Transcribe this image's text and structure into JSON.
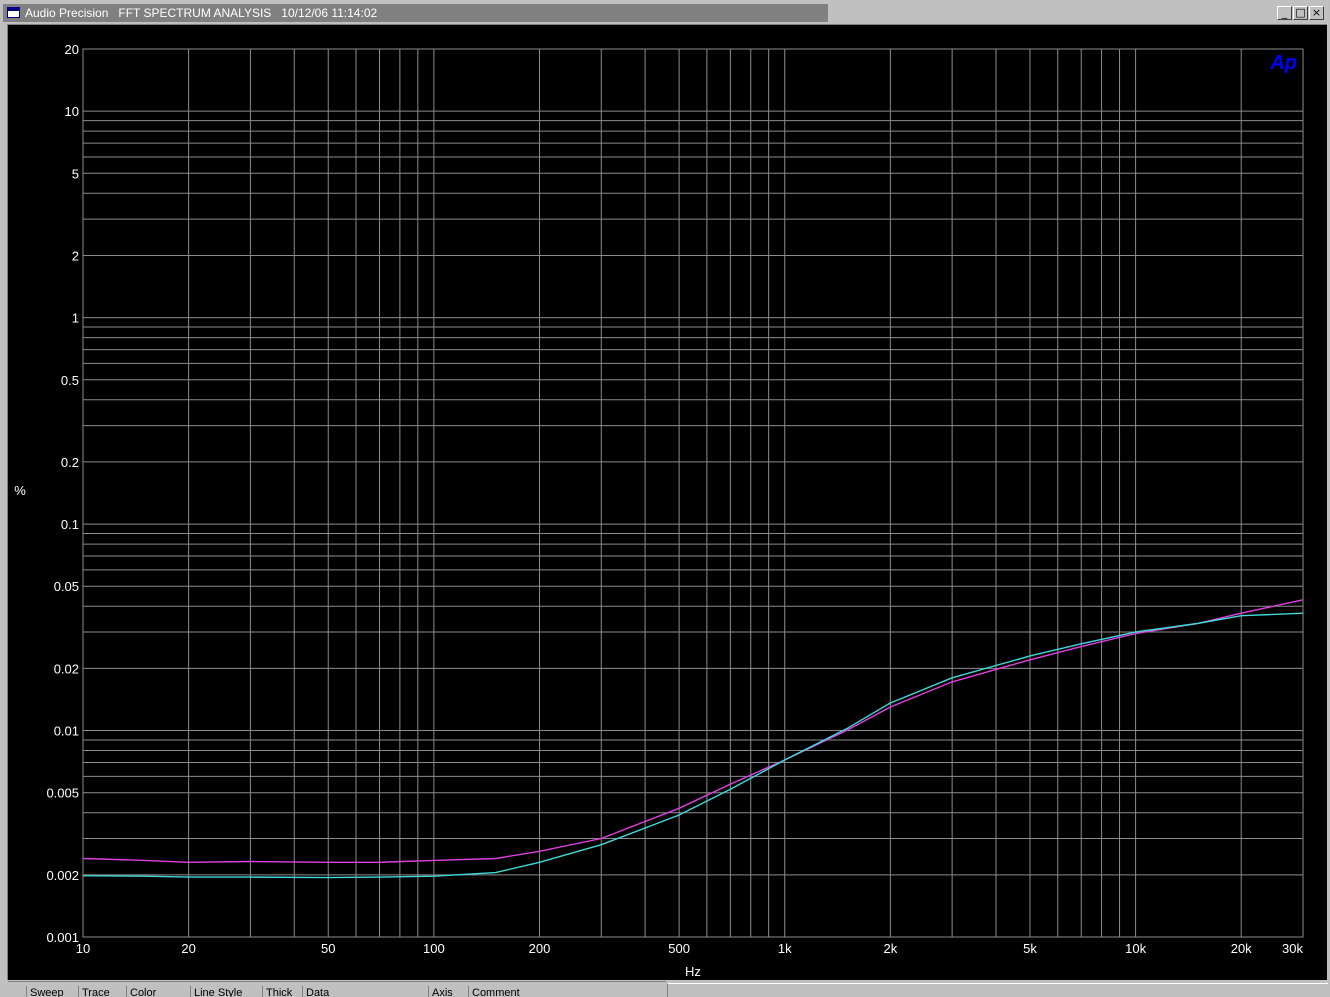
{
  "window": {
    "title": "Audio Precision   FFT SPECTRUM ANALYSIS   10/12/06 11:14:02",
    "minimize_glyph": "_",
    "maximize_glyph": "□",
    "close_glyph": "×"
  },
  "logo_text": "Ap",
  "legend_headers": [
    "Sweep",
    "Trace",
    "Color",
    "Line Style",
    "Thick",
    "Data",
    "Axis",
    "Comment"
  ],
  "colors": {
    "background": "#000000",
    "grid": "#8c8c8c",
    "axis_text": "#ffffff",
    "logo": "#0000ff"
  },
  "chart_data": {
    "type": "line",
    "title": "FFT SPECTRUM ANALYSIS",
    "xlabel": "Hz",
    "ylabel": "%",
    "x_scale": "log",
    "y_scale": "log",
    "xlim": [
      10,
      30000
    ],
    "ylim": [
      0.001,
      20
    ],
    "x_ticks": [
      {
        "v": 10,
        "label": "10"
      },
      {
        "v": 20,
        "label": "20"
      },
      {
        "v": 50,
        "label": "50"
      },
      {
        "v": 100,
        "label": "100"
      },
      {
        "v": 200,
        "label": "200"
      },
      {
        "v": 500,
        "label": "500"
      },
      {
        "v": 1000,
        "label": "1k"
      },
      {
        "v": 2000,
        "label": "2k"
      },
      {
        "v": 5000,
        "label": "5k"
      },
      {
        "v": 10000,
        "label": "10k"
      },
      {
        "v": 20000,
        "label": "20k"
      },
      {
        "v": 30000,
        "label": "30k"
      }
    ],
    "y_ticks": [
      {
        "v": 20,
        "label": "20"
      },
      {
        "v": 10,
        "label": "10"
      },
      {
        "v": 5,
        "label": "5"
      },
      {
        "v": 2,
        "label": "2"
      },
      {
        "v": 1,
        "label": "1"
      },
      {
        "v": 0.5,
        "label": "0.5"
      },
      {
        "v": 0.2,
        "label": "0.2"
      },
      {
        "v": 0.1,
        "label": "0.1"
      },
      {
        "v": 0.05,
        "label": "0.05"
      },
      {
        "v": 0.02,
        "label": "0.02"
      },
      {
        "v": 0.01,
        "label": "0.01"
      },
      {
        "v": 0.005,
        "label": "0.005"
      },
      {
        "v": 0.002,
        "label": "0.002"
      },
      {
        "v": 0.001,
        "label": "0.001"
      }
    ],
    "grid": true,
    "series": [
      {
        "color": "#e040e0",
        "x": [
          10,
          15,
          20,
          30,
          50,
          70,
          100,
          150,
          200,
          300,
          500,
          700,
          1000,
          1500,
          2000,
          3000,
          5000,
          7000,
          10000,
          15000,
          20000,
          30000
        ],
        "y": [
          0.0024,
          0.00235,
          0.0023,
          0.00232,
          0.0023,
          0.0023,
          0.00235,
          0.0024,
          0.0026,
          0.003,
          0.0042,
          0.0055,
          0.0072,
          0.01,
          0.013,
          0.0172,
          0.022,
          0.0255,
          0.0295,
          0.033,
          0.037,
          0.043
        ]
      },
      {
        "color": "#40d8d8",
        "x": [
          10,
          15,
          20,
          30,
          50,
          70,
          100,
          150,
          200,
          300,
          500,
          700,
          1000,
          1500,
          2000,
          3000,
          5000,
          7000,
          10000,
          15000,
          20000,
          30000
        ],
        "y": [
          0.00198,
          0.00197,
          0.00195,
          0.00195,
          0.00194,
          0.00195,
          0.00197,
          0.00205,
          0.0023,
          0.0028,
          0.0039,
          0.0052,
          0.0072,
          0.0102,
          0.0136,
          0.018,
          0.023,
          0.0263,
          0.03,
          0.033,
          0.036,
          0.037
        ]
      }
    ]
  }
}
